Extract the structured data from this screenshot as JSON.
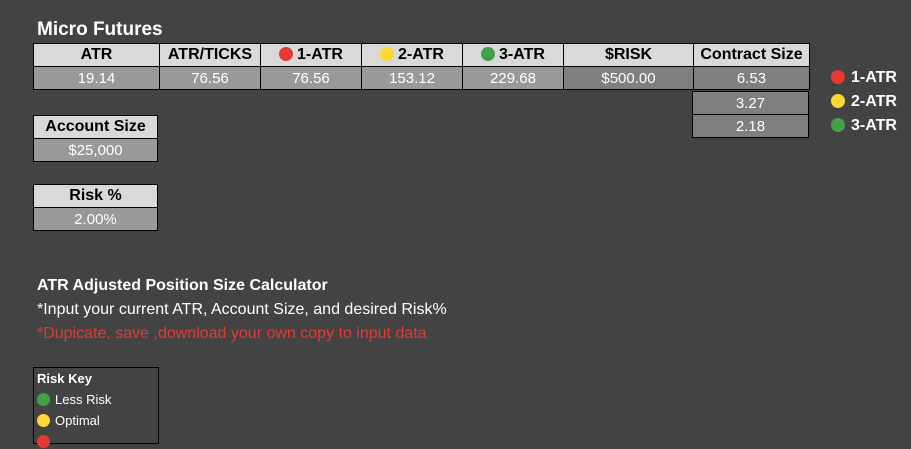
{
  "sheet": {
    "title": "Micro Futures",
    "main_table": {
      "headers": [
        "ATR",
        "ATR/TICKS",
        "1-ATR",
        "2-ATR",
        "3-ATR",
        "$RISK",
        "Contract Size"
      ],
      "values": [
        "19.14",
        "76.56",
        "76.56",
        "153.12",
        "229.68",
        "$500.00",
        "6.53"
      ]
    },
    "contract_sizes_extra": [
      "3.27",
      "2.18"
    ],
    "side_labels": [
      "1-ATR",
      "2-ATR",
      "3-ATR"
    ],
    "account": {
      "header": "Account Size",
      "value": "$25,000"
    },
    "risk": {
      "header": "Risk %",
      "value": "2.00%"
    },
    "calculator": {
      "title": "ATR Adjusted Position Size Calculator",
      "note": "*Input your current ATR, Account Size, and desired Risk%",
      "warning": "*Dupicate, save ,download your own copy to input data"
    },
    "risk_key": {
      "title": "Risk Key",
      "items": [
        "Less Risk",
        "Optimal"
      ]
    }
  },
  "colors": {
    "background": "#434343",
    "header": "#d9d9d9",
    "value_cell": "#999999",
    "red": "#e53935",
    "yellow": "#fdd835",
    "green": "#43a047"
  },
  "icons": [
    "red-circle-icon",
    "yellow-circle-icon",
    "green-circle-icon"
  ]
}
